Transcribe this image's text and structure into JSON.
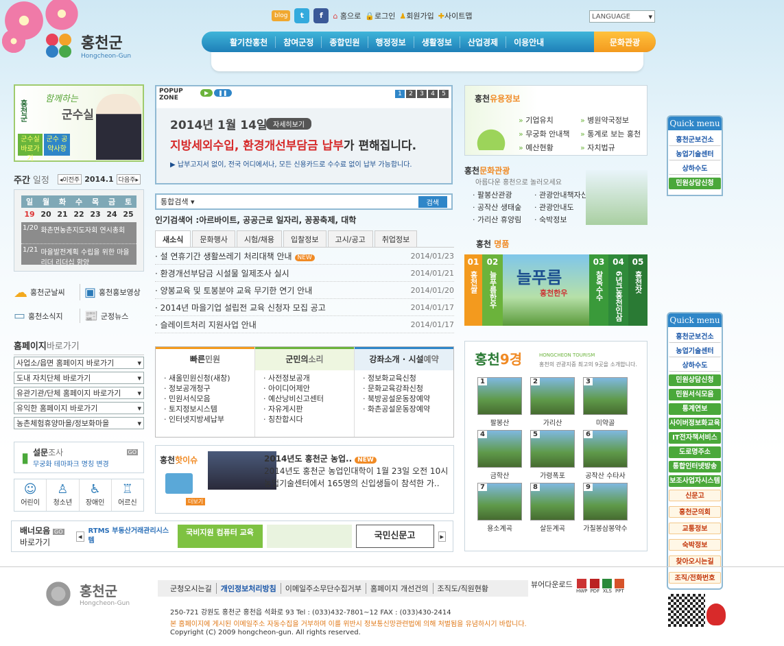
{
  "header": {
    "logo_text": "홍천군",
    "logo_sub": "Hongcheon-Gun",
    "util": [
      "홈으로",
      "로그인",
      "회원가입",
      "사이트맵"
    ],
    "blog": "blog",
    "language": "LANGUAGE"
  },
  "nav": [
    "활기찬홍천",
    "참여군정",
    "종합민원",
    "행정정보",
    "생활정보",
    "산업경제",
    "이용안내"
  ],
  "nav_culture": "문화관광",
  "mayor": {
    "brand": "홍천군",
    "slogan": "함께하는",
    "title": "군수실",
    "btn1": "군수실 바로가기",
    "btn2": "군수 공약사항"
  },
  "weekly": {
    "title_a": "주간",
    "title_b": "일정",
    "prev": "이전주",
    "next": "다음주",
    "month": "2014.1",
    "days": [
      "일",
      "월",
      "화",
      "수",
      "목",
      "금",
      "토"
    ],
    "dates": [
      "19",
      "20",
      "21",
      "22",
      "23",
      "24",
      "25"
    ],
    "events": [
      {
        "date": "1/20",
        "text": "화촌면농촌지도자회 연시총회"
      },
      {
        "date": "1/21",
        "text": "마을발전계획 수립을 위한 마을리더 리더십 함양"
      }
    ]
  },
  "quicklinks": [
    "홍천군날씨",
    "홍천홍보영상",
    "홍천소식지",
    "군정뉴스"
  ],
  "homepage": {
    "title_a": "홈페이지",
    "title_b": "바로가기",
    "selects": [
      "사업소/읍면 홈페이지 바로가기",
      "도내 자치단체 바로가기",
      "유관기관/단체 홈페이지 바로가기",
      "유익한 홈페이지 바로가기",
      "농촌체험휴양마을/정보화마을"
    ]
  },
  "survey": {
    "title_a": "설문",
    "title_b": "조사",
    "desc": "무궁화 테마파크 명칭 변경"
  },
  "people": [
    "어린이",
    "청소년",
    "장애인",
    "어르신"
  ],
  "banner": {
    "title_a": "배너모음",
    "title_b": "바로가기",
    "items": [
      "RTMS 부동산거래관리시스템",
      "국비지원 컴퓨터 교육",
      "국민신문고"
    ]
  },
  "popup": {
    "title": "POPUP ZONE",
    "pages": [
      "1",
      "2",
      "3",
      "4",
      "5"
    ],
    "date": "2014년 1월 14일",
    "detail": "자세히보기",
    "headline_a": "지방세외수입, 환경개선부담금 납부",
    "headline_b": "가 편해집니다.",
    "sub": "▶ 납부고지서 없이, 전국 어디에서나, 모든 신용카드로 수수료 없이 납부 가능합니다."
  },
  "search": {
    "scope": "통합검색",
    "btn": "검색",
    "popular_label": "인기검색어 :",
    "popular": "아르바이트, 공공근로 일자리, 꽁꽁축제, 대학"
  },
  "news": {
    "tabs": [
      "새소식",
      "문화행사",
      "시험/채용",
      "입찰정보",
      "고시/공고",
      "취업정보"
    ],
    "items": [
      {
        "title": "설 연휴기간 생활쓰레기 처리대책 안내",
        "date": "2014/01/23",
        "new": "NEW"
      },
      {
        "title": "환경개선부담금 시설물 일제조사 실시",
        "date": "2014/01/21"
      },
      {
        "title": "양봉교육 및 토봉분야 교육 무기한 연기 안내",
        "date": "2014/01/20"
      },
      {
        "title": "2014년 마을기업 설립전 교육 신청자 모집 공고",
        "date": "2014/01/17"
      },
      {
        "title": "슬레이트처리 지원사업 안내",
        "date": "2014/01/17"
      }
    ]
  },
  "service": {
    "col1": {
      "a": "빠른",
      "b": "민원",
      "items": [
        "새올민원신청(새창)",
        "정보공개청구",
        "민원서식모음",
        "토지정보시스템",
        "인터넷지방세납부"
      ]
    },
    "col2": {
      "a": "군민의",
      "b": "소리",
      "items": [
        "사전정보공개",
        "아이디어제안",
        "예산낭비신고센터",
        "자유게시판",
        "칭찬합시다"
      ]
    },
    "col3": {
      "a": "강좌소개 · 시설",
      "b": "예약",
      "items": [
        "정보화교육신청",
        "문화교육강좌신청",
        "북방공설운동장예약",
        "화촌공설운동장예약"
      ]
    }
  },
  "hot": {
    "title_a": "홍천",
    "title_b": "핫이슈",
    "more": "더보기",
    "headline": "2014년도 홍천군 농업..",
    "new": "NEW",
    "body": "2014년도 홍천군 농업인대학이 1월 23일 오전 10시 농업기술센터에서 165명의 신입생들이 참석한 가.."
  },
  "useful": {
    "title_a": "홍천",
    "title_b": "유용정보",
    "items": [
      "기업유치",
      "병원약국정보",
      "무궁화 안내책",
      "통계로 보는 홍천",
      "예산현황",
      "자치법규"
    ]
  },
  "culture": {
    "title_a": "홍천",
    "title_b": "문화관광",
    "sub": "아름다운 홍천으로 놀러오세요",
    "items": [
      "팔봉산관광",
      "관광안내책자신청",
      "공작산 생태숲",
      "관광안내도",
      "가리산 휴양림",
      "숙박정보"
    ]
  },
  "products": {
    "title_a": "홍천",
    "title_b": "명품",
    "nums": [
      {
        "n": "01",
        "t": "홍천쌀"
      },
      {
        "n": "02",
        "t": "늘푸름한우"
      },
      {
        "n": "03",
        "t": "찰옥수수"
      },
      {
        "n": "04",
        "t": "6년근홍천인삼"
      },
      {
        "n": "05",
        "t": "홍천잣"
      }
    ],
    "feature": "늘푸름",
    "feature_sub": "홍천한우"
  },
  "nine": {
    "title_a": "홍천",
    "title_b": "9경",
    "en": "HONGCHEON TOURISM",
    "desc": "홍천의 관광지중 최고의 9곳을 소개합니다.",
    "items": [
      "팔봉산",
      "가리산",
      "미약골",
      "금학산",
      "가령폭포",
      "공작산 수타사",
      "용소계곡",
      "살둔계곡",
      "가칠봉삼봉약수"
    ]
  },
  "quick": {
    "title": "Quick menu",
    "top": [
      "홍천군보건소",
      "농업기술센터",
      "상하수도",
      "민원상담신청"
    ],
    "blue": [
      "홍천군보건소",
      "농업기술센터",
      "상하수도"
    ],
    "green": [
      "민원상담신청",
      "민원서식모음",
      "통계연보",
      "사이버정보화교육",
      "IT전자책서비스",
      "도로명주소",
      "통합인터넷방송",
      "보조사업자시스템"
    ],
    "orange": [
      "신문고",
      "홍천군의회",
      "교통정보",
      "숙박정보",
      "찾아오시는길",
      "조직/전화번호"
    ]
  },
  "footer": {
    "links": [
      "군청오시는길",
      "개인정보처리방침",
      "이메일주소무단수집거부",
      "홈페이지 개선건의",
      "조직도/직원현황"
    ],
    "viewer": "뷰어다운로드",
    "viewers": [
      "HWP",
      "PDF",
      "XLS",
      "PPT"
    ],
    "address": "250-721 강원도 홍천군 홍천읍 석화로 93 Tel : (033)432-7801~12 FAX : (033)430-2414",
    "warning": "본 홈페이지에 게시된 이메일주소 자동수집을 거부하며 이를 위반시 정보통신망관련법에 의해 처벌됨을 유념하시기 바랍니다.",
    "copyright": "Copyright (C) 2009 hongcheon-gun. All rights reserved."
  },
  "colors": {
    "nav_blue": "#1e7fb8",
    "accent_orange": "#f39a1e",
    "green": "#4aa83a",
    "headline_red": "#d62a2a"
  }
}
